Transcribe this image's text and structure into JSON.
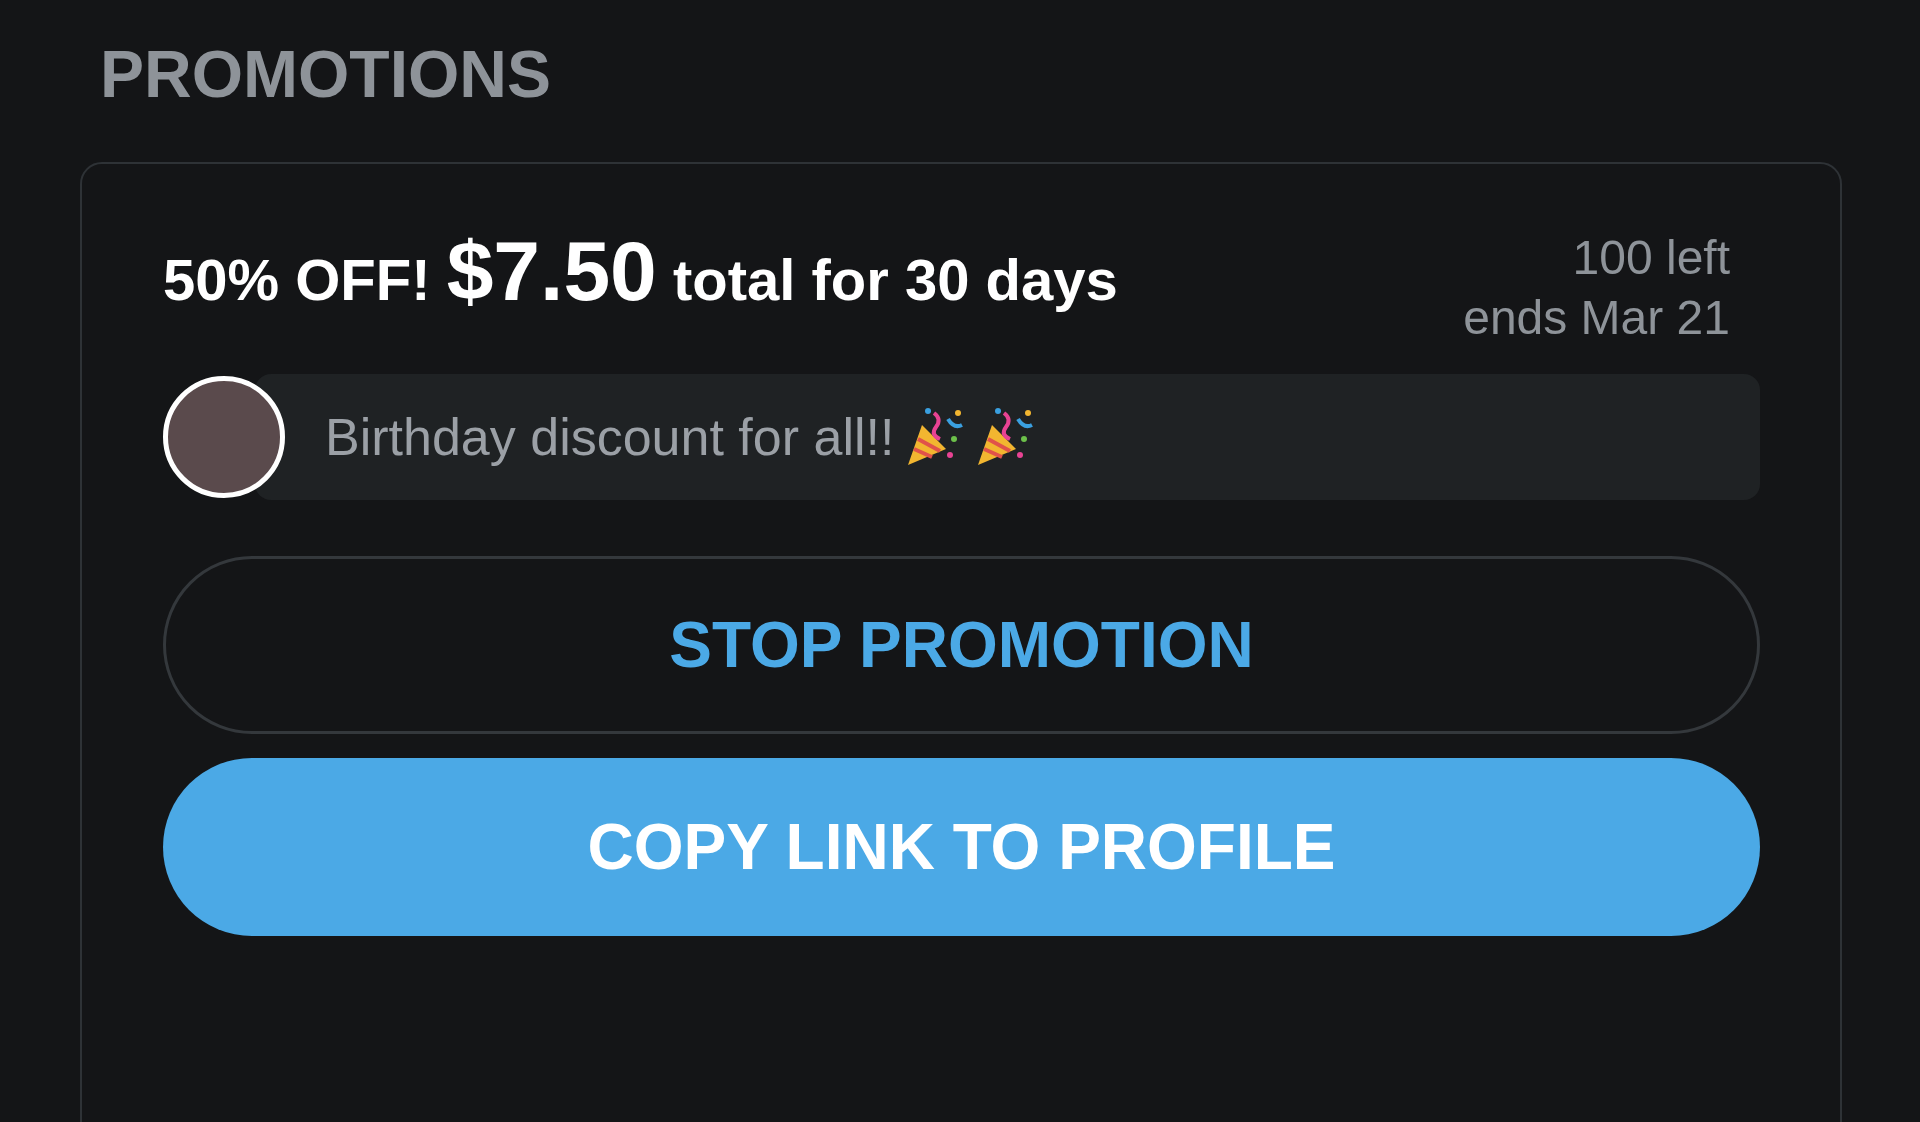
{
  "section_title": "PROMOTIONS",
  "promotion": {
    "discount": "50% OFF!",
    "price": "$7.50",
    "terms": "total for 30 days",
    "remaining": "100 left",
    "ends": "ends Mar 21",
    "message": "Birthday discount for all!!"
  },
  "buttons": [
    {
      "label": "STOP PROMOTION",
      "kind": "outline"
    },
    {
      "label": "COPY LINK TO PROFILE",
      "kind": "filled"
    }
  ]
}
